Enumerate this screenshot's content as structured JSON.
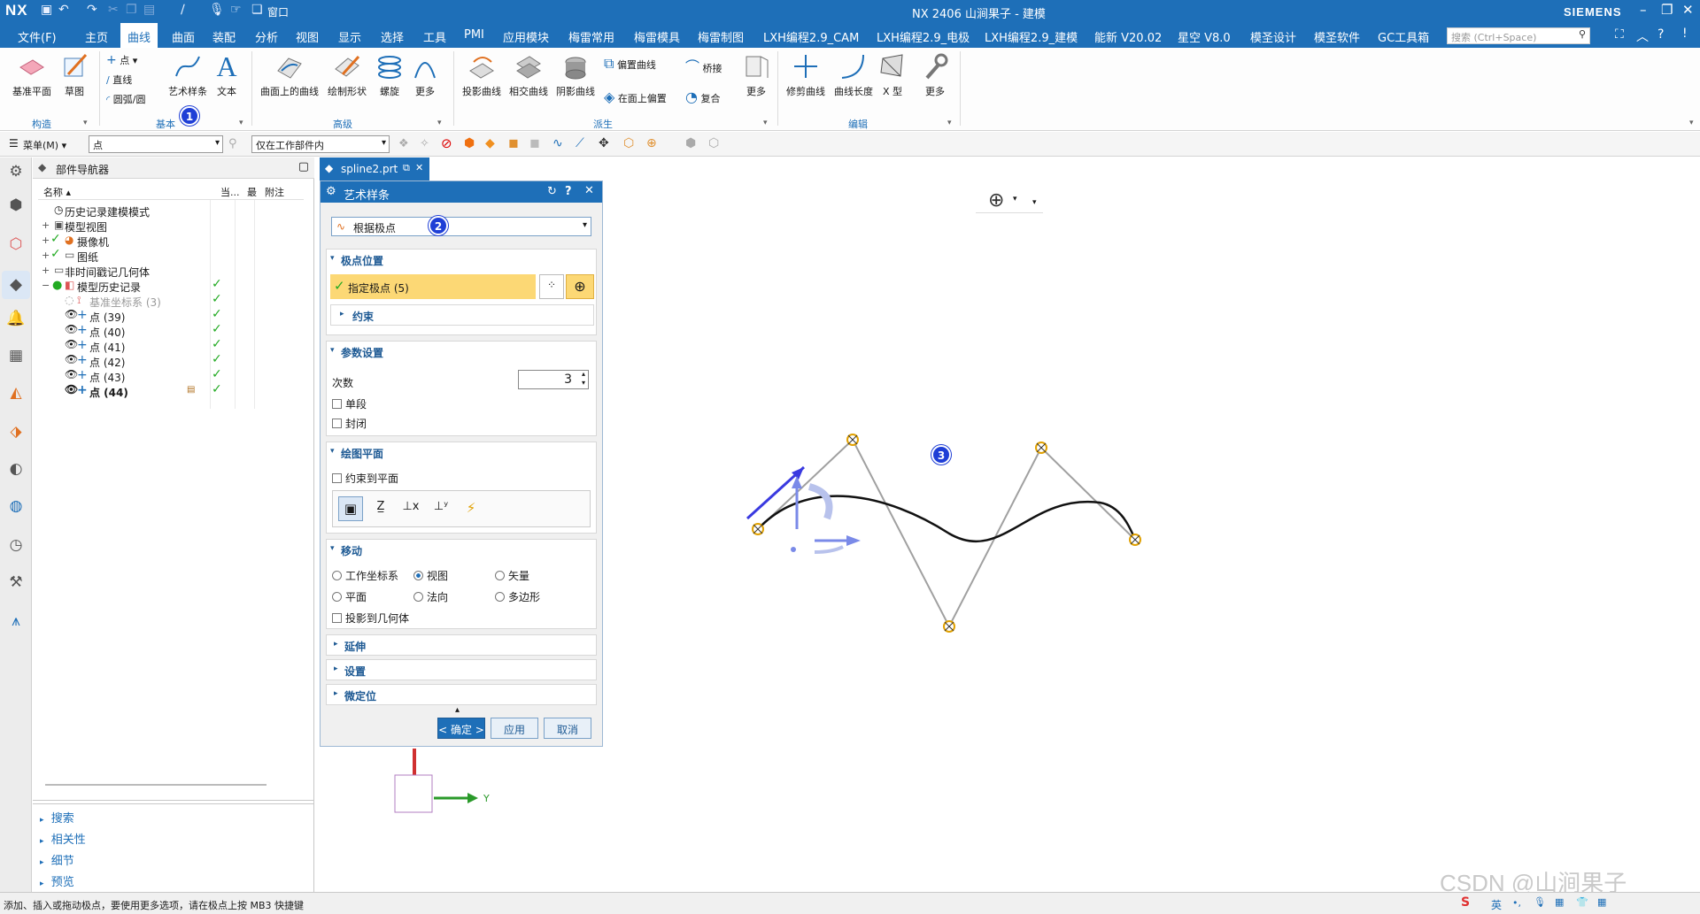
{
  "titlebar": {
    "logo": "NX",
    "title": "NX 2406 山涧果子 - 建模",
    "brand": "SIEMENS",
    "window_menu": "窗口"
  },
  "menubar": {
    "items": [
      "文件(F)",
      "主页",
      "曲线",
      "曲面",
      "装配",
      "分析",
      "视图",
      "显示",
      "选择",
      "工具",
      "PMI",
      "应用模块",
      "梅雷常用",
      "梅雷模具",
      "梅雷制图",
      "LXH编程2.9_CAM",
      "LXH编程2.9_电极",
      "LXH编程2.9_建模",
      "能新 V20.02",
      "星空 V8.0",
      "模圣设计",
      "模圣软件",
      "GC工具箱"
    ],
    "active": "曲线",
    "search_placeholder": "搜索 (Ctrl+Space)"
  },
  "ribbon": {
    "groups": {
      "construct": "构造",
      "basic": "基本",
      "advanced": "高级",
      "derive": "派生",
      "edit": "编辑"
    },
    "buttons": {
      "datum_plane": "基准平面",
      "sketch": "草图",
      "point": "点",
      "line": "直线",
      "arc": "圆弧/圆",
      "studio_spline": "艺术样条",
      "text": "文本",
      "curve_on_surface": "曲面上的曲线",
      "draw_shape": "绘制形状",
      "helix": "螺旋",
      "more1": "更多",
      "project_curve": "投影曲线",
      "intersect_curve": "相交曲线",
      "shadow_curve": "阴影曲线",
      "offset_curve": "偏置曲线",
      "bridge": "桥接",
      "offset_in_face": "在面上偏置",
      "composite": "复合",
      "more2": "更多",
      "trim_curve": "修剪曲线",
      "curve_length": "曲线长度",
      "x_form": "X 型",
      "more3": "更多"
    }
  },
  "selbar": {
    "menu": "菜单(M)",
    "filter": "点",
    "scope": "仅在工作部件内"
  },
  "navigator": {
    "title": "部件导航器",
    "columns": {
      "name": "名称",
      "current": "当...",
      "latest": "最",
      "attach": "附注"
    },
    "rows": [
      {
        "label": "历史记录建模模式",
        "pm": "",
        "check": ""
      },
      {
        "label": "模型视图",
        "pm": "+",
        "check": ""
      },
      {
        "label": "摄像机",
        "pm": "+",
        "check": ""
      },
      {
        "label": "图纸",
        "pm": "+",
        "check": ""
      },
      {
        "label": "非时间戳记几何体",
        "pm": "+",
        "check": ""
      },
      {
        "label": "模型历史记录",
        "pm": "−",
        "check": "✓"
      },
      {
        "label": "基准坐标系 (3)",
        "pm": "",
        "check": "✓"
      },
      {
        "label": "点 (39)",
        "pm": "",
        "check": "✓"
      },
      {
        "label": "点 (40)",
        "pm": "",
        "check": "✓"
      },
      {
        "label": "点 (41)",
        "pm": "",
        "check": "✓"
      },
      {
        "label": "点 (42)",
        "pm": "",
        "check": "✓"
      },
      {
        "label": "点 (43)",
        "pm": "",
        "check": "✓"
      },
      {
        "label": "点 (44)",
        "pm": "",
        "check": "✓"
      }
    ],
    "bottom": [
      "搜索",
      "相关性",
      "细节",
      "预览"
    ]
  },
  "doctab": {
    "name": "spline2.prt"
  },
  "dialog": {
    "title": "艺术样条",
    "type": "根据极点",
    "pole_section": "极点位置",
    "specify_pole": "指定极点 (5)",
    "constraint": "约束",
    "param_section": "参数设置",
    "degree_label": "次数",
    "degree_value": "3",
    "single_segment": "单段",
    "closed": "封闭",
    "plane_section": "绘图平面",
    "constrain_to_plane": "约束到平面",
    "move_section": "移动",
    "move_options": [
      "工作坐标系",
      "视图",
      "矢量",
      "平面",
      "法向",
      "多边形"
    ],
    "move_selected": "视图",
    "project_to_geom": "投影到几何体",
    "extend": "延伸",
    "settings": "设置",
    "micro": "微定位",
    "ok": "< 确定 >",
    "apply": "应用",
    "cancel": "取消"
  },
  "badges": [
    "1",
    "2",
    "3"
  ],
  "canvas": {
    "axis_y": "Y"
  },
  "status": {
    "message": "添加、插入或拖动极点，要使用更多选项，请在极点上按 MB3 快捷键",
    "watermark": "CSDN @山涧果子",
    "ime": "英"
  }
}
